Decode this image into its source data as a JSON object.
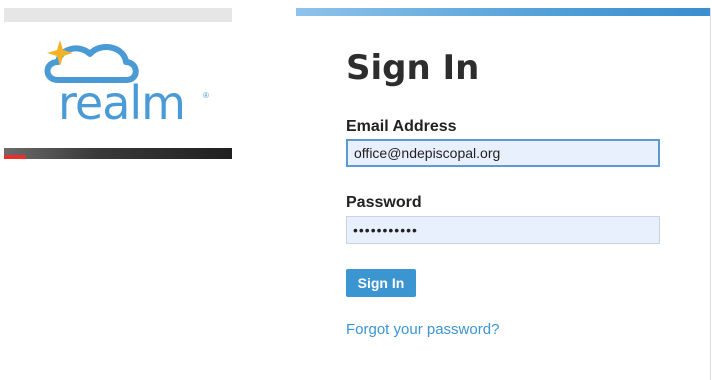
{
  "brand": {
    "logo_text": "realm",
    "logo_mark": "®",
    "logo_icon": "cloud-sparkle-icon",
    "colors": {
      "blue": "#4a9bd5",
      "star": "#f5b324"
    }
  },
  "video": {
    "progress_color": "#e8302a"
  },
  "form": {
    "title": "Sign In",
    "email_label": "Email Address",
    "email_value": "office@ndepiscopal.org",
    "password_label": "Password",
    "password_value": "•••••••••••",
    "submit_label": "Sign In",
    "forgot_label": "Forgot your password?",
    "accent_color": "#3b95d1"
  }
}
